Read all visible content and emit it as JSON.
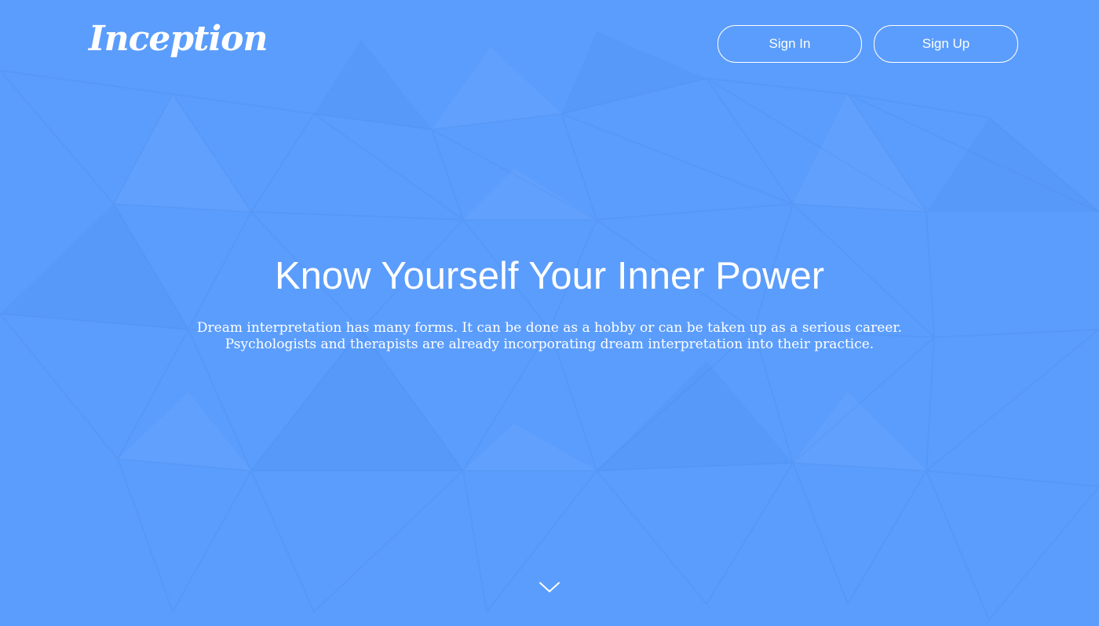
{
  "brand": {
    "logo_text": "Inception"
  },
  "header": {
    "sign_in_label": "Sign In",
    "sign_up_label": "Sign Up"
  },
  "hero": {
    "title": "Know Yourself Your Inner Power",
    "description_line1": "Dream interpretation has many forms. It can be done as a hobby or can be taken up as a serious career.",
    "description_line2": "Psychologists and therapists are already incorporating dream interpretation into their practice."
  },
  "scroll_indicator": {
    "icon": "chevron-down-icon"
  },
  "colors": {
    "background": "#5b9dfc",
    "foreground": "#ffffff"
  }
}
